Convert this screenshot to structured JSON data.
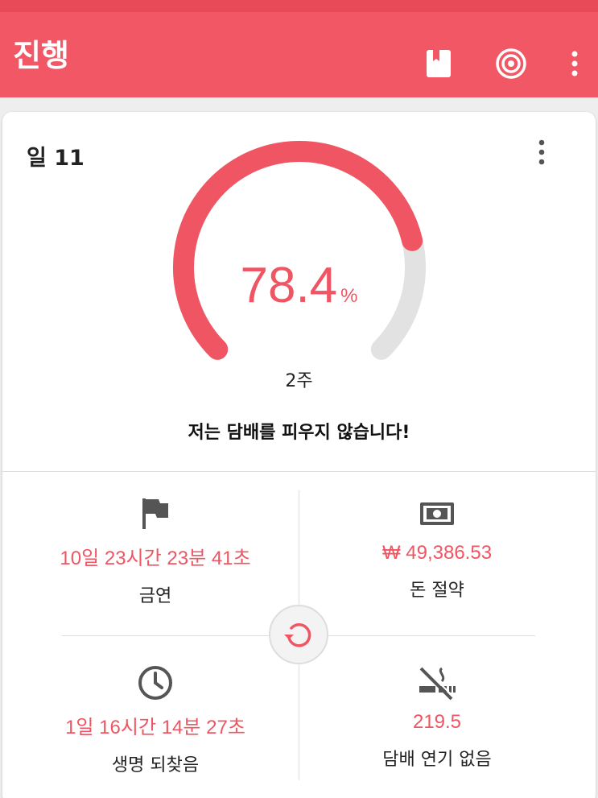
{
  "appbar": {
    "title": "진행",
    "icons": [
      "bookmark-book-icon",
      "target-icon",
      "more-vert-icon"
    ],
    "color": "#f25766"
  },
  "card": {
    "day_label": "일 11",
    "progress": {
      "percent_value": "78.4",
      "percent_unit": "%",
      "fraction": 0.784,
      "goal_label": "2주"
    },
    "motto": "저는 담배를 피우지 않습니다!",
    "stats": [
      {
        "icon": "flag-icon",
        "value": "10일 23시간 23분 41초",
        "label": "금연"
      },
      {
        "icon": "money-icon",
        "value": "₩ 49,386.53",
        "label": "돈 절약"
      },
      {
        "icon": "clock-icon",
        "value": "1일 16시간 14분 27초",
        "label": "생명 되찾음"
      },
      {
        "icon": "no-smoking-icon",
        "value": "219.5",
        "label": "담배 연기 없음"
      }
    ]
  },
  "colors": {
    "accent": "#ef5562",
    "track": "#e2e2e2"
  }
}
